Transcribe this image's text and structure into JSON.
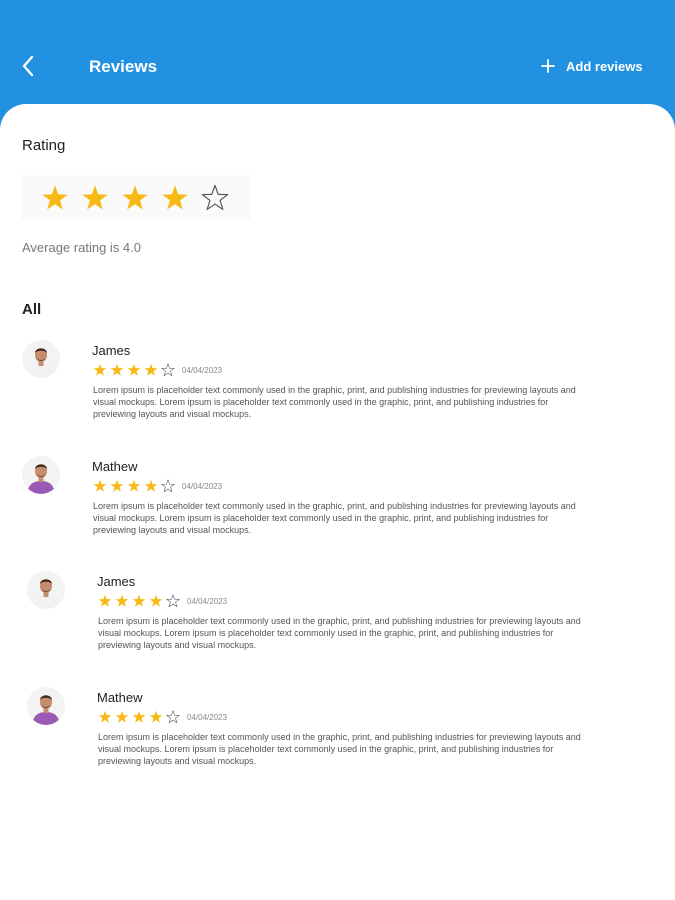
{
  "header": {
    "title": "Reviews",
    "add_label": "Add reviews",
    "back_icon": "chevron-left-icon",
    "add_icon": "plus-icon",
    "background": "#2291e2"
  },
  "rating": {
    "label": "Rating",
    "value": 4,
    "max": 5,
    "average_text": "Average rating is 4.0",
    "star_color": "#f6b915"
  },
  "all_label": "All",
  "reviews": [
    {
      "name": "James",
      "stars": 4,
      "date": "04/04/2023",
      "text": "Lorem ipsum is placeholder text commonly used in the graphic, print, and publishing industries for previewing layouts and visual mockups. Lorem ipsum is placeholder text commonly used in the graphic, print, and publishing industries for previewing layouts and visual mockups.",
      "shirt_color": "#f2f2f2"
    },
    {
      "name": "Mathew",
      "stars": 4,
      "date": "04/04/2023",
      "text": "Lorem ipsum is placeholder text commonly used in the graphic, print, and publishing industries for previewing layouts and visual mockups. Lorem ipsum is placeholder text commonly used in the graphic, print, and publishing industries for previewing layouts and visual mockups.",
      "shirt_color": "#9b59b6"
    },
    {
      "name": "James",
      "stars": 4,
      "date": "04/04/2023",
      "text": "Lorem ipsum is placeholder text commonly used in the graphic, print, and publishing industries for previewing layouts and visual mockups. Lorem ipsum is placeholder text commonly used in the graphic, print, and publishing industries for previewing layouts and visual mockups.",
      "shirt_color": "#f2f2f2"
    },
    {
      "name": "Mathew",
      "stars": 4,
      "date": "04/04/2023",
      "text": "Lorem ipsum is placeholder text commonly used in the graphic, print, and publishing industries for previewing layouts and visual mockups. Lorem ipsum is placeholder text commonly used in the graphic, print, and publishing industries for previewing layouts and visual mockups.",
      "shirt_color": "#9b59b6"
    }
  ]
}
